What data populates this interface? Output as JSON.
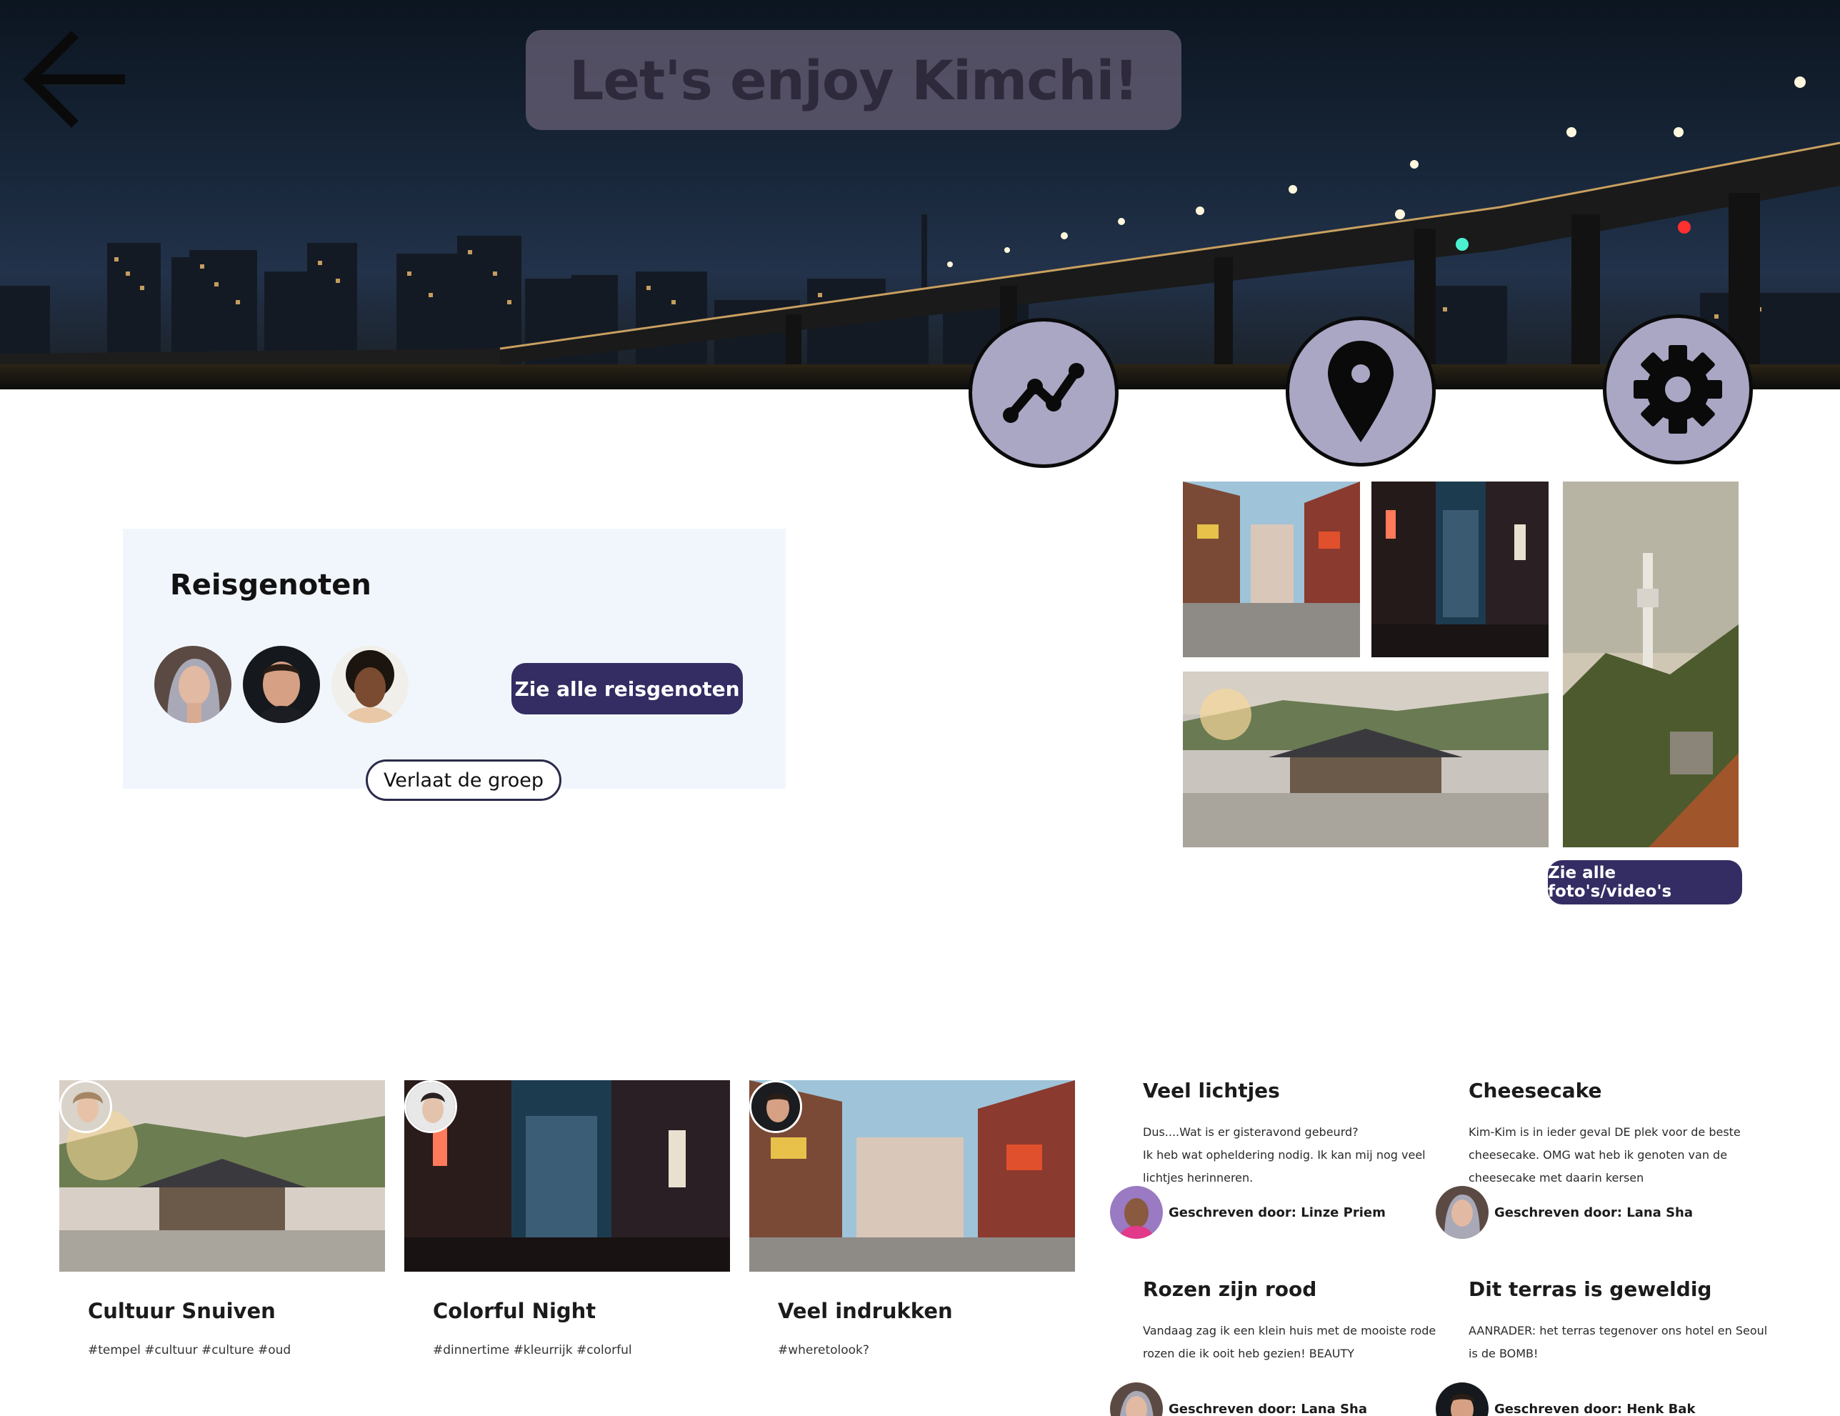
{
  "header": {
    "title": "Let's enjoy Kimchi!",
    "back_icon": "arrow-left-icon"
  },
  "nav_buttons": [
    {
      "icon": "chart-line-icon"
    },
    {
      "icon": "map-pin-icon"
    },
    {
      "icon": "gear-icon"
    }
  ],
  "companions": {
    "heading": "Reisgenoten",
    "see_all_label": "Zie alle reisgenoten",
    "leave_label": "Verlaat de groep"
  },
  "gallery": {
    "see_all_label": "Zie alle foto's/video's"
  },
  "posts": [
    {
      "title": "Cultuur Snuiven",
      "tags": "#tempel #cultuur #culture #oud"
    },
    {
      "title": "Colorful Night",
      "tags": "#dinnertime #kleurrijk #colorful"
    },
    {
      "title": "Veel indrukken",
      "tags": "#wheretolook?"
    }
  ],
  "blogs": [
    {
      "title": "Veel lichtjes",
      "lines": [
        "Dus....Wat is er gisteravond gebeurd?",
        "Ik heb wat opheldering nodig. Ik kan mij nog veel",
        "lichtjes herinneren."
      ],
      "author": "Geschreven door: Linze Priem"
    },
    {
      "title": "Cheesecake",
      "lines": [
        "Kim-Kim is in ieder geval DE plek voor de beste",
        "cheesecake. OMG wat heb ik genoten van de",
        "cheesecake met daarin kersen"
      ],
      "author": "Geschreven door: Lana Sha"
    },
    {
      "title": "Rozen zijn rood",
      "lines": [
        "Vandaag zag ik een klein huis met de mooiste rode",
        "rozen die ik ooit heb gezien! BEAUTY"
      ],
      "author": "Geschreven door: Lana Sha"
    },
    {
      "title": "Dit terras is geweldig",
      "lines": [
        "AANRADER: het terras tegenover ons hotel en Seoul",
        "is de BOMB!"
      ],
      "author": "Geschreven door: Henk Bak"
    }
  ],
  "colors": {
    "primary": "#332d63",
    "icon_circle": "#a9a7c4",
    "card_bg": "#f1f6fd",
    "title_pill": "#625a70"
  }
}
